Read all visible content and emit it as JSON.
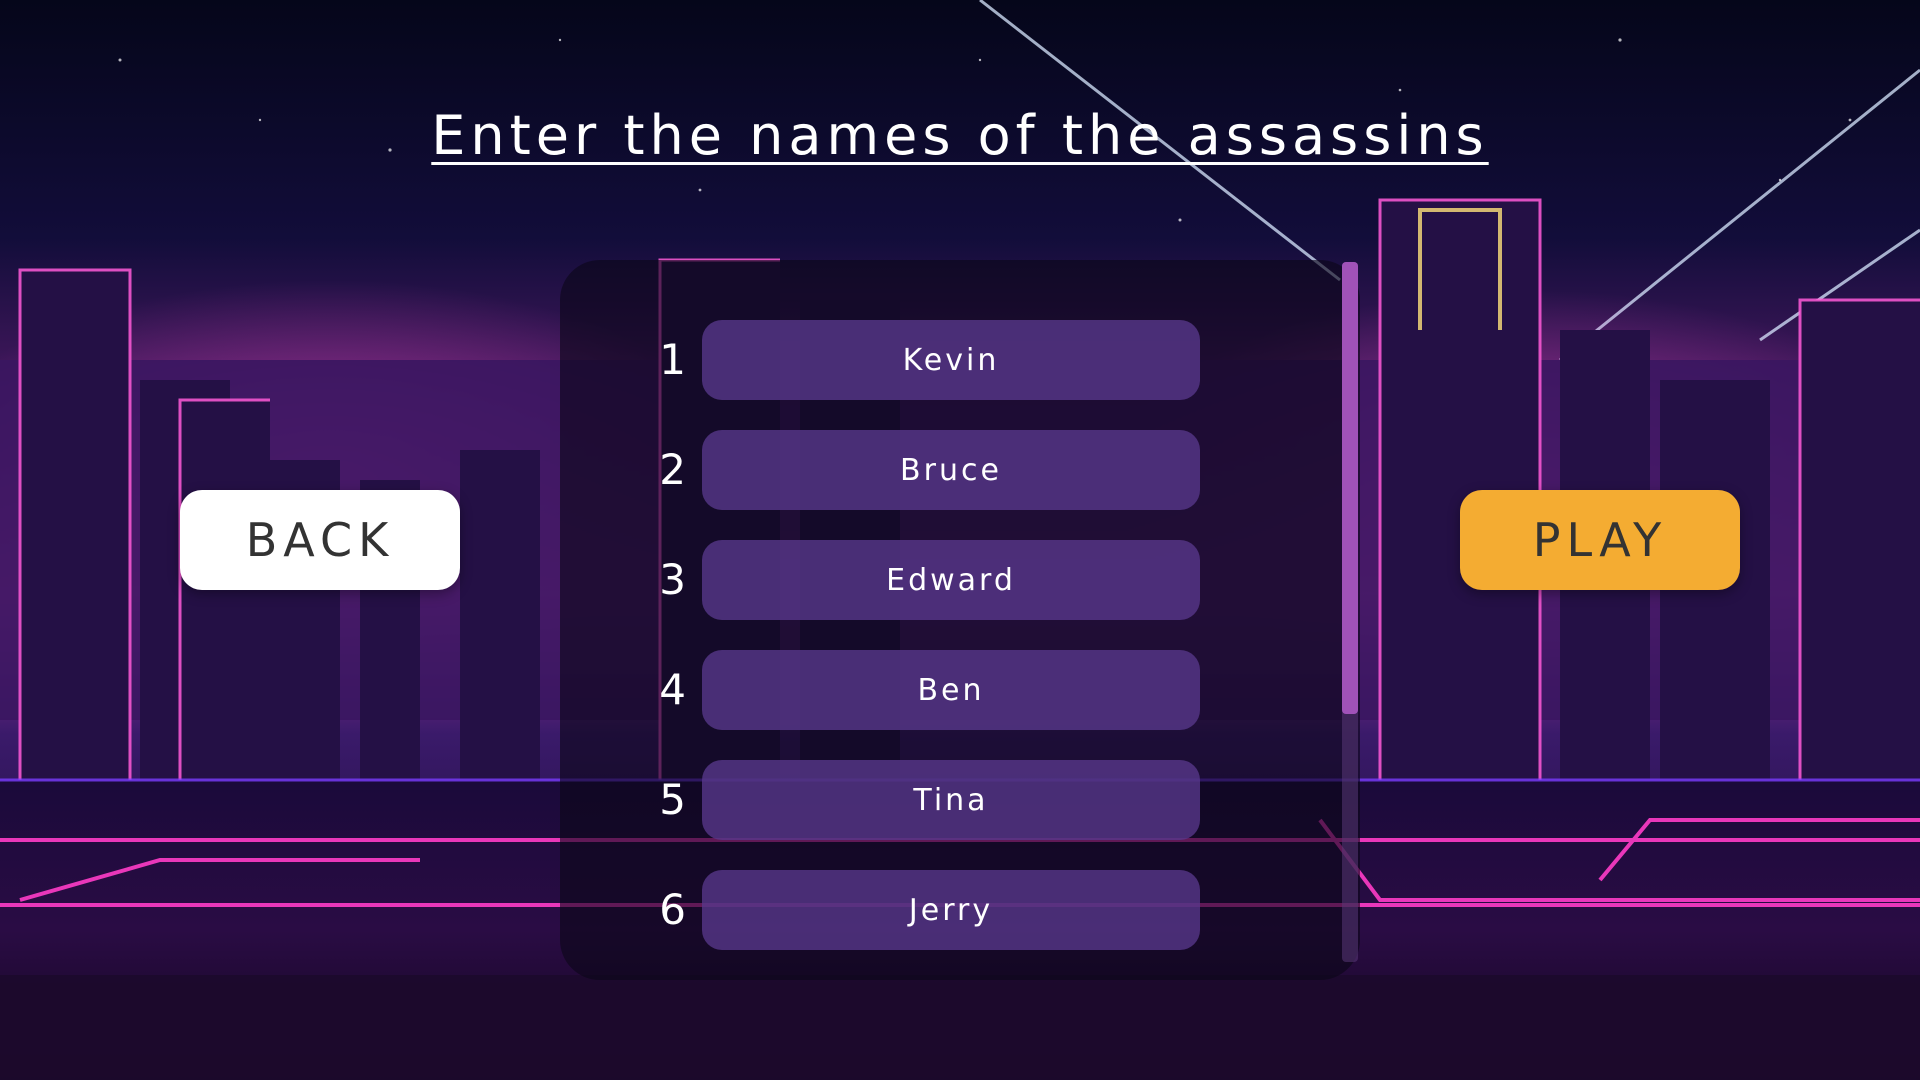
{
  "title": "Enter the names of the assassins",
  "back_label": "BACK",
  "play_label": "PLAY",
  "players": [
    {
      "number": "1",
      "name": "Kevin"
    },
    {
      "number": "2",
      "name": "Bruce"
    },
    {
      "number": "3",
      "name": "Edward"
    },
    {
      "number": "4",
      "name": "Ben"
    },
    {
      "number": "5",
      "name": "Tina"
    },
    {
      "number": "6",
      "name": "Jerry"
    }
  ],
  "scroll_position": 0,
  "colors": {
    "play_button": "#f4ac32",
    "back_button": "#ffffff",
    "name_field": "#58388c",
    "scroll_thumb": "#a052b8",
    "neon_pink": "#ff3cc8"
  }
}
